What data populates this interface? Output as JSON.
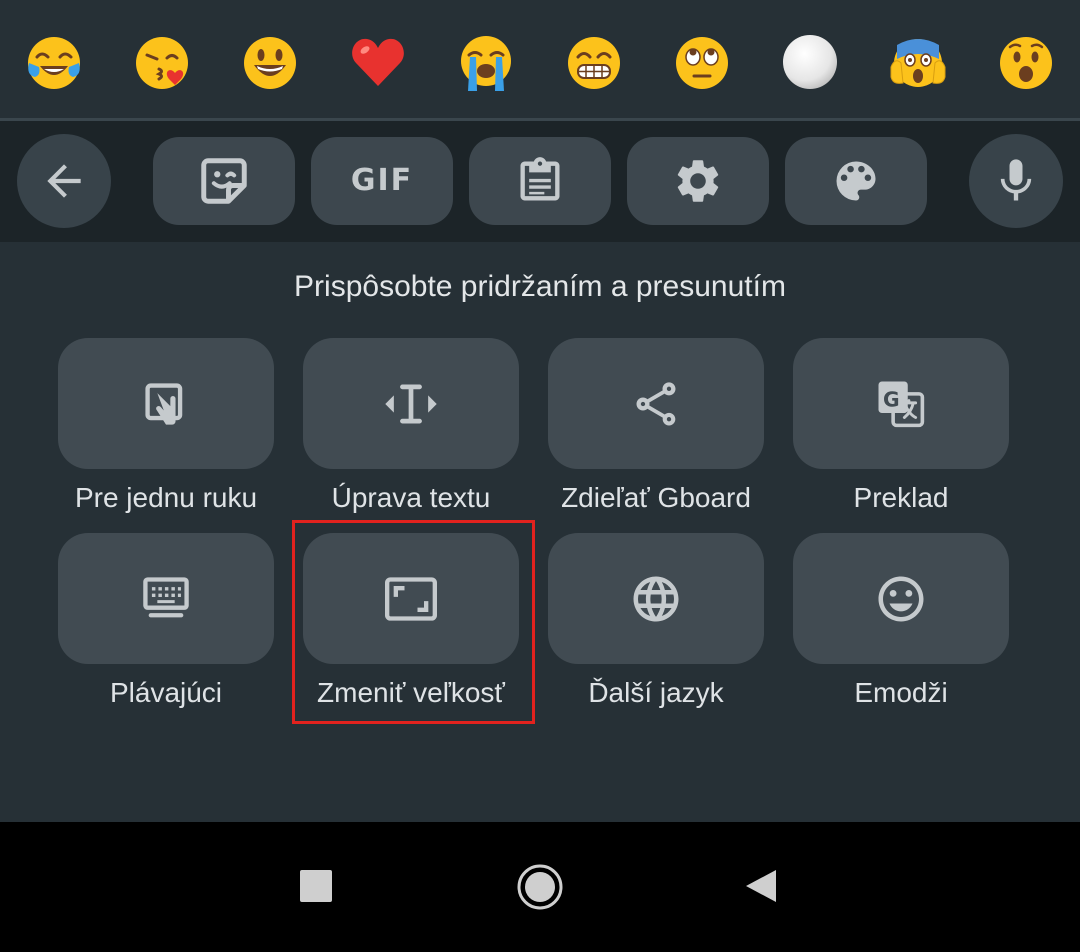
{
  "emoji_bar": {
    "items": [
      {
        "icon": "face-with-tears-of-joy-icon"
      },
      {
        "icon": "face-blowing-kiss-icon"
      },
      {
        "icon": "grinning-face-icon"
      },
      {
        "icon": "red-heart-icon"
      },
      {
        "icon": "loudly-crying-face-icon"
      },
      {
        "icon": "beaming-face-icon"
      },
      {
        "icon": "face-with-rolling-eyes-icon"
      },
      {
        "icon": "white-circle-icon"
      },
      {
        "icon": "face-screaming-in-fear-icon"
      },
      {
        "icon": "face-with-open-mouth-icon"
      }
    ]
  },
  "toolbar": {
    "back_icon": "arrow-left-icon",
    "sticker_icon": "sticker-icon",
    "gif_label": "GIF",
    "clipboard_icon": "clipboard-icon",
    "settings_icon": "gear-icon",
    "theme_icon": "palette-icon",
    "voice_icon": "microphone-icon"
  },
  "panel": {
    "title": "Prispôsobte pridržaním a presunutím",
    "tiles": [
      {
        "label": "Pre jednu ruku",
        "icon": "one-handed-icon"
      },
      {
        "label": "Úprava textu",
        "icon": "text-cursor-icon"
      },
      {
        "label": "Zdieľať Gboard",
        "icon": "share-icon"
      },
      {
        "label": "Preklad",
        "icon": "translate-icon"
      },
      {
        "label": "Plávajúci",
        "icon": "floating-keyboard-icon"
      },
      {
        "label": "Zmeniť veľkosť",
        "icon": "resize-icon"
      },
      {
        "label": "Ďalší jazyk",
        "icon": "globe-icon"
      },
      {
        "label": "Emodži",
        "icon": "smiley-icon"
      }
    ]
  },
  "navbar": {
    "recents_icon": "square-recents-icon",
    "home_icon": "circle-home-icon",
    "back_icon": "triangle-back-icon"
  },
  "colors": {
    "background": "#263036",
    "toolbar_bg": "#1c2428",
    "tile_bg": "#414b52",
    "icon_gray": "#c5cacd",
    "text": "#e3e6e8",
    "highlight": "#e2221e"
  }
}
